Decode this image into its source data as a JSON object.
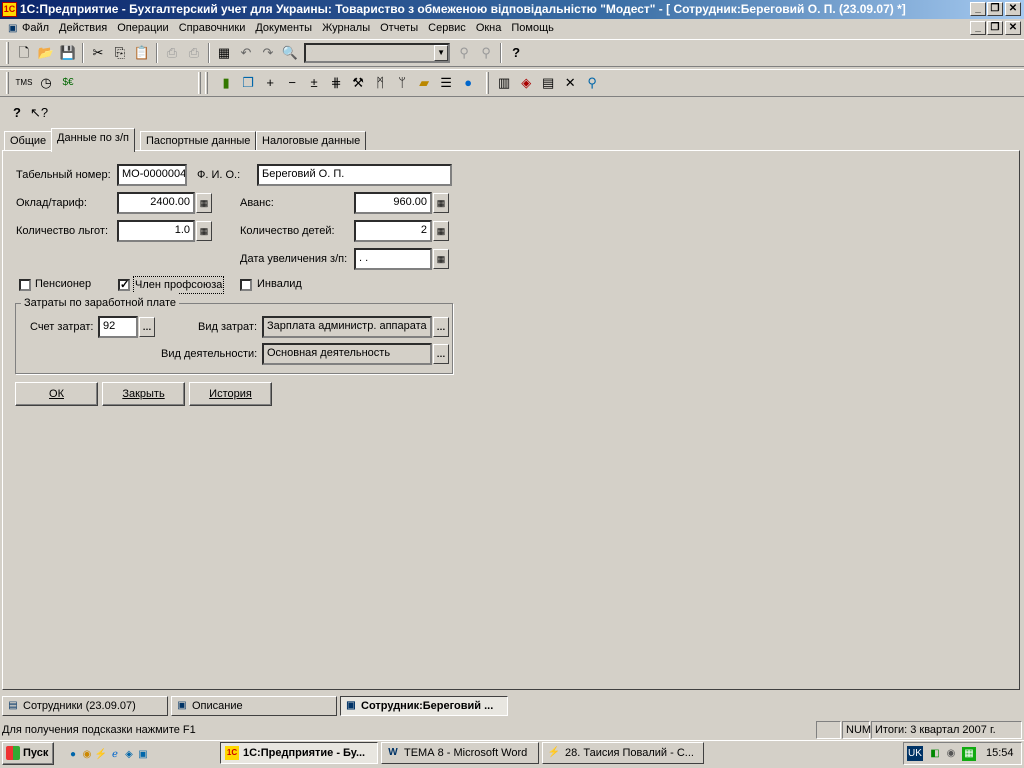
{
  "window": {
    "title": "1С:Предприятие - Бухгалтерский учет для Украины: Товариство  з  обмеженою  відповідальністю  \"Модест\" - [ Сотрудник:Береговий О. П. (23.09.07) *]"
  },
  "menu": [
    "Файл",
    "Действия",
    "Операции",
    "Справочники",
    "Документы",
    "Журналы",
    "Отчеты",
    "Сервис",
    "Окна",
    "Помощь"
  ],
  "tabs": [
    "Общие",
    "Данные по з/п",
    "Паспортные данные",
    "Налоговые данные"
  ],
  "form": {
    "tab_num_label": "Табельный номер:",
    "tab_num": "МО-0000004",
    "fio_label": "Ф. И. О.:",
    "fio": "Береговий О. П.",
    "salary_label": "Оклад/тариф:",
    "salary": "2400.00",
    "advance_label": "Аванс:",
    "advance": "960.00",
    "benefits_label": "Количество льгот:",
    "benefits": "1.0",
    "children_label": "Количество детей:",
    "children": "2",
    "raise_date_label": "Дата увеличения з/п:",
    "raise_date": " .  .",
    "pensioner_label": "Пенсионер",
    "union_label": "Член профсоюза",
    "disabled_label": "Инвалид",
    "pensioner": false,
    "union": true,
    "disabled": false,
    "costs_group": "Затраты по заработной плате",
    "account_label": "Счет затрат:",
    "account": "92",
    "cost_type_label": "Вид затрат:",
    "cost_type": "Зарплата администр. аппарата",
    "activity_label": "Вид деятельности:",
    "activity": "Основная деятельность"
  },
  "buttons": {
    "ok": "ОК",
    "close": "Закрыть",
    "history": "История"
  },
  "mdi_tabs": [
    "Сотрудники (23.09.07)",
    "Описание",
    "Сотрудник:Береговий ..."
  ],
  "status": {
    "hint": "Для получения подсказки нажмите F1",
    "num": "NUM",
    "totals": "Итоги: 3 квартал 2007 г."
  },
  "taskbar": {
    "start": "Пуск",
    "items": [
      "1С:Предприятие - Бу...",
      "ТЕМА 8 - Microsoft Word",
      "28. Таисия Повалий - С..."
    ],
    "lang": "UK",
    "clock": "15:54"
  }
}
